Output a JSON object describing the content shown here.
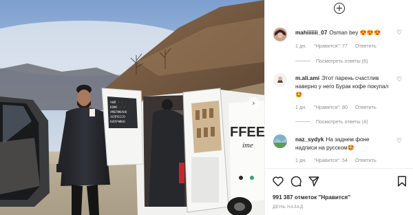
{
  "photo": {
    "van_sign_line1": "FFEE",
    "van_sign_line2": "ime",
    "menu_lines": [
      "ЧАЙ  ·  ·",
      "КОФЕ  ·  ·",
      "АМЕРИКАНО",
      "ЭСПРЕССО",
      "КАПУЧИНО"
    ]
  },
  "comments": [
    {
      "user": "mahiiiiiii_07",
      "text": "Osman bey 😍😍😍",
      "time": "1 дн.",
      "likes": "\"Нравится\": 77",
      "reply": "Ответить",
      "view_replies": "Посмотреть ответы (6)"
    },
    {
      "user": "m.ali.ami",
      "text": "Этот парень счастлив наверно у него Бурак кофе покупал 🤩",
      "time": "1 дн.",
      "likes": "\"Нравится\": 80",
      "reply": "Ответить",
      "view_replies": "Посмотреть ответы (4)"
    },
    {
      "user": "naz_sydyk",
      "text": "На заднем фоне надписи на русском🤩",
      "time": "1 дн.",
      "likes": "\"Нравится\": 54",
      "reply": "Ответить"
    }
  ],
  "post": {
    "likes_count": "991 387",
    "likes_label": "отметок \"Нравится\"",
    "time_ago": "ДЕНЬ НАЗАД"
  }
}
